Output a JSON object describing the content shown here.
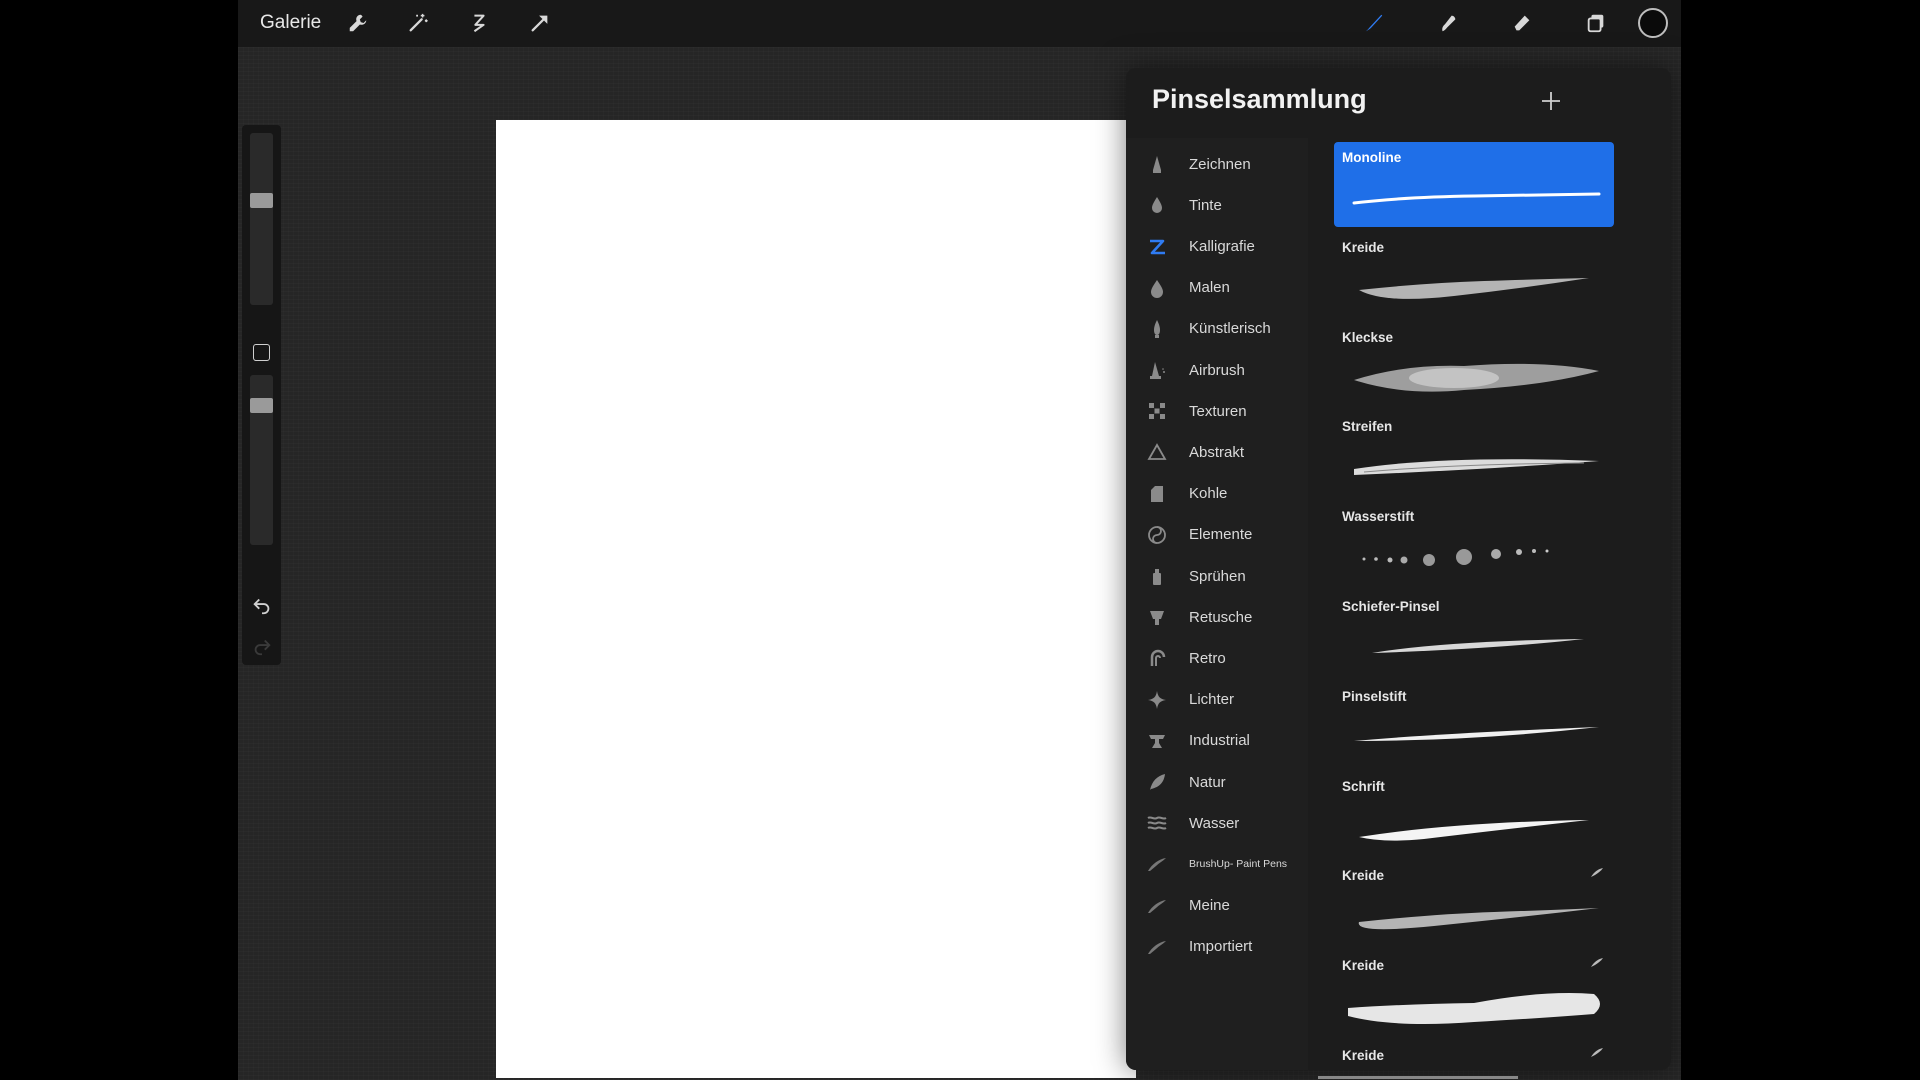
{
  "topbar": {
    "gallery_label": "Galerie",
    "left_tools": [
      "wrench-icon",
      "magic-wand-icon",
      "selection-icon",
      "transform-arrow-icon"
    ],
    "right_tools": [
      "brush-icon",
      "smudge-icon",
      "eraser-icon",
      "layers-icon"
    ],
    "color": "#0a0a0a"
  },
  "sidebar": {
    "tools": [
      "brush-size-slider",
      "modify-button",
      "opacity-slider",
      "undo-icon",
      "redo-icon"
    ]
  },
  "panel": {
    "title": "Pinselsammlung",
    "add_icon": "plus-icon",
    "sets": [
      {
        "label": "Zeichnen",
        "icon": "pencil-icon"
      },
      {
        "label": "Tinte",
        "icon": "ink-drop-icon"
      },
      {
        "label": "Kalligrafie",
        "icon": "calligraphy-icon",
        "active": true
      },
      {
        "label": "Malen",
        "icon": "paint-drop-icon"
      },
      {
        "label": "Künstlerisch",
        "icon": "artistic-brush-icon"
      },
      {
        "label": "Airbrush",
        "icon": "airbrush-icon"
      },
      {
        "label": "Texturen",
        "icon": "texture-icon"
      },
      {
        "label": "Abstrakt",
        "icon": "triangle-icon"
      },
      {
        "label": "Kohle",
        "icon": "charcoal-icon"
      },
      {
        "label": "Elemente",
        "icon": "yin-yang-icon"
      },
      {
        "label": "Sprühen",
        "icon": "spray-can-icon"
      },
      {
        "label": "Retusche",
        "icon": "retouch-icon"
      },
      {
        "label": "Retro",
        "icon": "retro-icon"
      },
      {
        "label": "Lichter",
        "icon": "sparkle-icon"
      },
      {
        "label": "Industrial",
        "icon": "anvil-icon"
      },
      {
        "label": "Natur",
        "icon": "leaf-icon"
      },
      {
        "label": "Wasser",
        "icon": "water-waves-icon"
      },
      {
        "label": "BrushUp- Paint Pens",
        "icon": "feather-icon"
      },
      {
        "label": "Meine",
        "icon": "feather-icon"
      },
      {
        "label": "Importiert",
        "icon": "feather-icon"
      }
    ],
    "brushes": [
      {
        "name": "Monoline",
        "selected": true,
        "stroke": "monoline"
      },
      {
        "name": "Kreide",
        "stroke": "chalk"
      },
      {
        "name": "Kleckse",
        "stroke": "blotch"
      },
      {
        "name": "Streifen",
        "stroke": "stripes"
      },
      {
        "name": "Wasserstift",
        "stroke": "dots"
      },
      {
        "name": "Schiefer-Pinsel",
        "stroke": "slate"
      },
      {
        "name": "Pinselstift",
        "stroke": "brushpen"
      },
      {
        "name": "Schrift",
        "stroke": "script"
      },
      {
        "name": "Kreide",
        "stroke": "chalk2",
        "imported": true
      },
      {
        "name": "Kreide",
        "stroke": "chalk-wide",
        "imported": true
      },
      {
        "name": "Kreide",
        "stroke": "chalk3",
        "imported": true
      }
    ]
  },
  "colors": {
    "accent": "#1f6fe8",
    "panel_bg": "#1c1c1c",
    "canvas": "#ffffff"
  }
}
